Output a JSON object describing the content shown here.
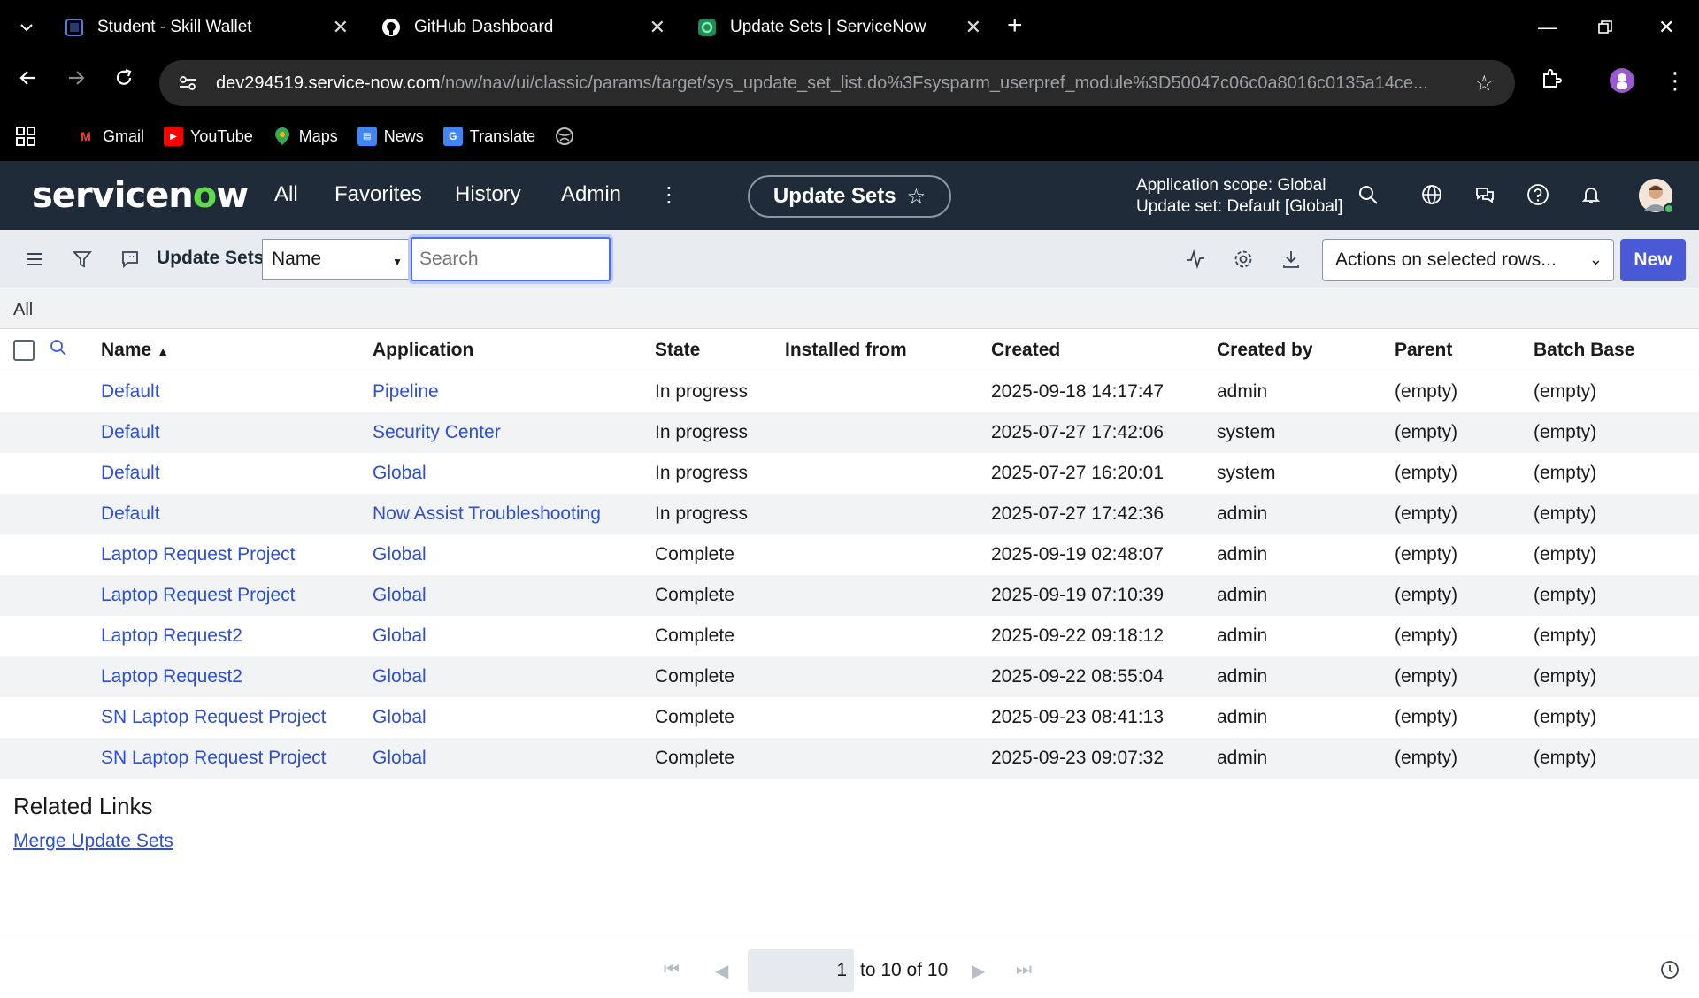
{
  "browser": {
    "tabs": [
      {
        "title": "Student - Skill Wallet",
        "icon": "skill-wallet-icon"
      },
      {
        "title": "GitHub Dashboard",
        "icon": "github-icon"
      },
      {
        "title": "Update Sets | ServiceNow",
        "icon": "servicenow-icon",
        "active": true
      }
    ],
    "url_host": "dev294519.service-now.com",
    "url_path": "/now/nav/ui/classic/params/target/sys_update_set_list.do%3Fsysparm_userpref_module%3D50047c06c0a8016c0135a14ce...",
    "bookmarks": [
      {
        "label": "Gmail",
        "icon": "gmail-icon"
      },
      {
        "label": "YouTube",
        "icon": "youtube-icon"
      },
      {
        "label": "Maps",
        "icon": "maps-icon"
      },
      {
        "label": "News",
        "icon": "news-icon"
      },
      {
        "label": "Translate",
        "icon": "translate-icon"
      }
    ]
  },
  "header": {
    "logo_pre": "servicen",
    "logo_o": "o",
    "logo_post": "w",
    "nav": [
      "All",
      "Favorites",
      "History",
      "Admin"
    ],
    "pill_label": "Update Sets",
    "scope_line1": "Application scope: Global",
    "scope_line2": "Update set: Default [Global]"
  },
  "toolbar": {
    "title": "Update Sets",
    "field_select": "Name",
    "search_placeholder": "Search",
    "actions_label": "Actions on selected rows...",
    "new_label": "New"
  },
  "breadcrumb": "All",
  "table": {
    "columns": [
      "Name",
      "Application",
      "State",
      "Installed from",
      "Created",
      "Created by",
      "Parent",
      "Batch Base"
    ],
    "rows": [
      {
        "name": "Default",
        "application": "Pipeline",
        "state": "In progress",
        "installed_from": "",
        "created": "2025-09-18 14:17:47",
        "created_by": "admin",
        "parent": "(empty)",
        "batch_base": "(empty)"
      },
      {
        "name": "Default",
        "application": "Security Center",
        "state": "In progress",
        "installed_from": "",
        "created": "2025-07-27 17:42:06",
        "created_by": "system",
        "parent": "(empty)",
        "batch_base": "(empty)"
      },
      {
        "name": "Default",
        "application": "Global",
        "state": "In progress",
        "installed_from": "",
        "created": "2025-07-27 16:20:01",
        "created_by": "system",
        "parent": "(empty)",
        "batch_base": "(empty)"
      },
      {
        "name": "Default",
        "application": "Now Assist Troubleshooting",
        "state": "In progress",
        "installed_from": "",
        "created": "2025-07-27 17:42:36",
        "created_by": "admin",
        "parent": "(empty)",
        "batch_base": "(empty)"
      },
      {
        "name": "Laptop Request Project",
        "application": "Global",
        "state": "Complete",
        "installed_from": "",
        "created": "2025-09-19 02:48:07",
        "created_by": "admin",
        "parent": "(empty)",
        "batch_base": "(empty)"
      },
      {
        "name": "Laptop Request Project",
        "application": "Global",
        "state": "Complete",
        "installed_from": "",
        "created": "2025-09-19 07:10:39",
        "created_by": "admin",
        "parent": "(empty)",
        "batch_base": "(empty)"
      },
      {
        "name": "Laptop Request2",
        "application": "Global",
        "state": "Complete",
        "installed_from": "",
        "created": "2025-09-22 09:18:12",
        "created_by": "admin",
        "parent": "(empty)",
        "batch_base": "(empty)"
      },
      {
        "name": "Laptop Request2",
        "application": "Global",
        "state": "Complete",
        "installed_from": "",
        "created": "2025-09-22 08:55:04",
        "created_by": "admin",
        "parent": "(empty)",
        "batch_base": "(empty)"
      },
      {
        "name": "SN Laptop Request Project",
        "application": "Global",
        "state": "Complete",
        "installed_from": "",
        "created": "2025-09-23 08:41:13",
        "created_by": "admin",
        "parent": "(empty)",
        "batch_base": "(empty)"
      },
      {
        "name": "SN Laptop Request Project",
        "application": "Global",
        "state": "Complete",
        "installed_from": "",
        "created": "2025-09-23 09:07:32",
        "created_by": "admin",
        "parent": "(empty)",
        "batch_base": "(empty)"
      }
    ]
  },
  "related": {
    "title": "Related Links",
    "link": "Merge Update Sets"
  },
  "pagination": {
    "page": "1",
    "range_text": "to 10 of 10"
  },
  "colors": {
    "header_bg": "#1f2b38",
    "accent": "#4a5ad6",
    "link": "#2f4fd1",
    "logo_green": "#62d84e"
  }
}
